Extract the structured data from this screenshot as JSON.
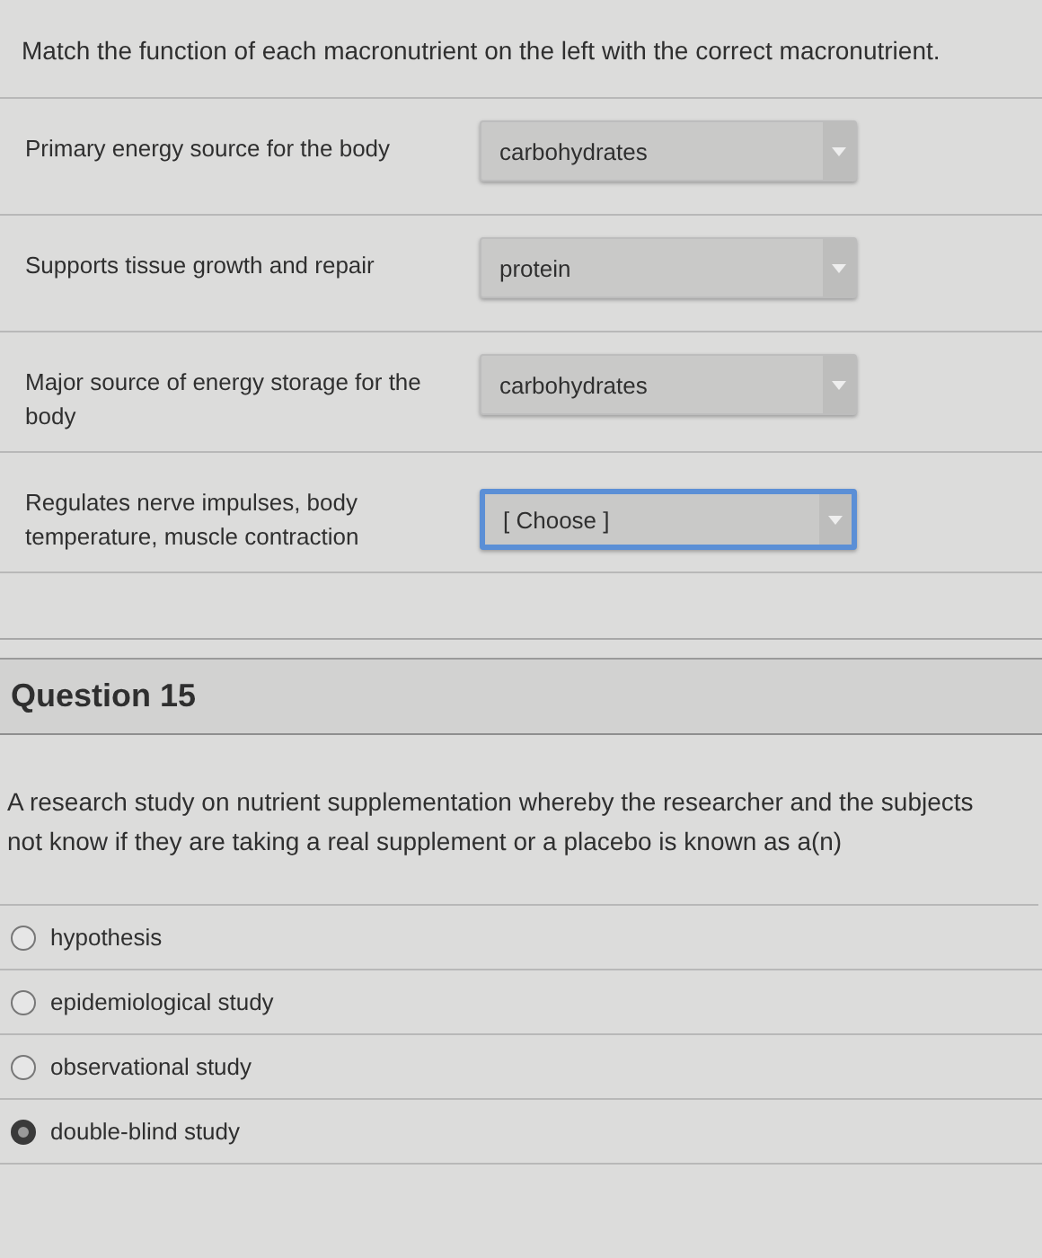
{
  "matching": {
    "prompt": "Match the function of each macronutrient on the left with the correct macronutrient.",
    "rows": [
      {
        "label": "Primary energy source for the body",
        "answer": "carbohydrates",
        "focused": false
      },
      {
        "label": "Supports tissue growth and repair",
        "answer": "protein",
        "focused": false
      },
      {
        "label": "Major source of energy storage for the body",
        "answer": "carbohydrates",
        "focused": false
      },
      {
        "label": "Regulates nerve impulses, body temperature, muscle contraction",
        "answer": "[ Choose ]",
        "focused": true
      }
    ]
  },
  "question": {
    "title": "Question 15",
    "text": "A research study on nutrient supplementation whereby the researcher and the subjects not know if they are taking a real supplement or a placebo is known as a(n)",
    "options": [
      {
        "label": "hypothesis",
        "selected": false
      },
      {
        "label": "epidemiological study",
        "selected": false
      },
      {
        "label": "observational study",
        "selected": false
      },
      {
        "label": "double-blind study",
        "selected": true
      }
    ]
  }
}
